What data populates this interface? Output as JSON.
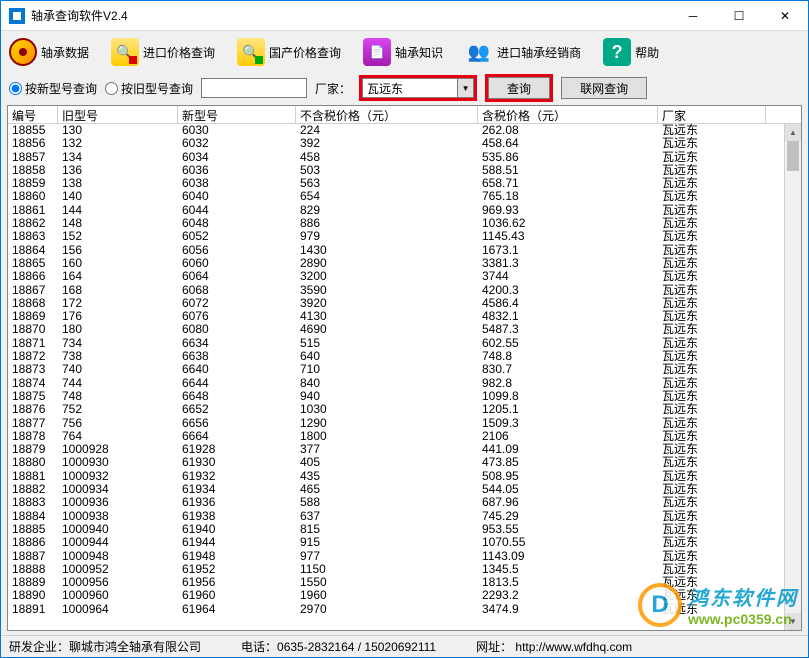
{
  "window": {
    "title": "轴承查询软件V2.4"
  },
  "toolbar": {
    "data": "轴承数据",
    "import_price": "进口价格查询",
    "domestic_price": "国产价格查询",
    "knowledge": "轴承知识",
    "dealer": "进口轴承经销商",
    "help": "帮助"
  },
  "search": {
    "by_new": "按新型号查询",
    "by_old": "按旧型号查询",
    "manufacturer_label": "厂家：",
    "manufacturer_value": "瓦远东",
    "query_btn": "查询",
    "online_btn": "联网查询"
  },
  "columns": {
    "c0": "编号",
    "c1": "旧型号",
    "c2": "新型号",
    "c3": "不含税价格（元）",
    "c4": "含税价格（元）",
    "c5": "厂家"
  },
  "rows": [
    {
      "id": "18855",
      "old": "130",
      "new": "6030",
      "pnt": "224",
      "pt": "262.08",
      "mk": "瓦远东"
    },
    {
      "id": "18856",
      "old": "132",
      "new": "6032",
      "pnt": "392",
      "pt": "458.64",
      "mk": "瓦远东"
    },
    {
      "id": "18857",
      "old": "134",
      "new": "6034",
      "pnt": "458",
      "pt": "535.86",
      "mk": "瓦远东"
    },
    {
      "id": "18858",
      "old": "136",
      "new": "6036",
      "pnt": "503",
      "pt": "588.51",
      "mk": "瓦远东"
    },
    {
      "id": "18859",
      "old": "138",
      "new": "6038",
      "pnt": "563",
      "pt": "658.71",
      "mk": "瓦远东"
    },
    {
      "id": "18860",
      "old": "140",
      "new": "6040",
      "pnt": "654",
      "pt": "765.18",
      "mk": "瓦远东"
    },
    {
      "id": "18861",
      "old": "144",
      "new": "6044",
      "pnt": "829",
      "pt": "969.93",
      "mk": "瓦远东"
    },
    {
      "id": "18862",
      "old": "148",
      "new": "6048",
      "pnt": "886",
      "pt": "1036.62",
      "mk": "瓦远东"
    },
    {
      "id": "18863",
      "old": "152",
      "new": "6052",
      "pnt": "979",
      "pt": "1145.43",
      "mk": "瓦远东"
    },
    {
      "id": "18864",
      "old": "156",
      "new": "6056",
      "pnt": "1430",
      "pt": "1673.1",
      "mk": "瓦远东"
    },
    {
      "id": "18865",
      "old": "160",
      "new": "6060",
      "pnt": "2890",
      "pt": "3381.3",
      "mk": "瓦远东"
    },
    {
      "id": "18866",
      "old": "164",
      "new": "6064",
      "pnt": "3200",
      "pt": "3744",
      "mk": "瓦远东"
    },
    {
      "id": "18867",
      "old": "168",
      "new": "6068",
      "pnt": "3590",
      "pt": "4200.3",
      "mk": "瓦远东"
    },
    {
      "id": "18868",
      "old": "172",
      "new": "6072",
      "pnt": "3920",
      "pt": "4586.4",
      "mk": "瓦远东"
    },
    {
      "id": "18869",
      "old": "176",
      "new": "6076",
      "pnt": "4130",
      "pt": "4832.1",
      "mk": "瓦远东"
    },
    {
      "id": "18870",
      "old": "180",
      "new": "6080",
      "pnt": "4690",
      "pt": "5487.3",
      "mk": "瓦远东"
    },
    {
      "id": "18871",
      "old": "734",
      "new": "6634",
      "pnt": "515",
      "pt": "602.55",
      "mk": "瓦远东"
    },
    {
      "id": "18872",
      "old": "738",
      "new": "6638",
      "pnt": "640",
      "pt": "748.8",
      "mk": "瓦远东"
    },
    {
      "id": "18873",
      "old": "740",
      "new": "6640",
      "pnt": "710",
      "pt": "830.7",
      "mk": "瓦远东"
    },
    {
      "id": "18874",
      "old": "744",
      "new": "6644",
      "pnt": "840",
      "pt": "982.8",
      "mk": "瓦远东"
    },
    {
      "id": "18875",
      "old": "748",
      "new": "6648",
      "pnt": "940",
      "pt": "1099.8",
      "mk": "瓦远东"
    },
    {
      "id": "18876",
      "old": "752",
      "new": "6652",
      "pnt": "1030",
      "pt": "1205.1",
      "mk": "瓦远东"
    },
    {
      "id": "18877",
      "old": "756",
      "new": "6656",
      "pnt": "1290",
      "pt": "1509.3",
      "mk": "瓦远东"
    },
    {
      "id": "18878",
      "old": "764",
      "new": "6664",
      "pnt": "1800",
      "pt": "2106",
      "mk": "瓦远东"
    },
    {
      "id": "18879",
      "old": "1000928",
      "new": "61928",
      "pnt": "377",
      "pt": "441.09",
      "mk": "瓦远东"
    },
    {
      "id": "18880",
      "old": "1000930",
      "new": "61930",
      "pnt": "405",
      "pt": "473.85",
      "mk": "瓦远东"
    },
    {
      "id": "18881",
      "old": "1000932",
      "new": "61932",
      "pnt": "435",
      "pt": "508.95",
      "mk": "瓦远东"
    },
    {
      "id": "18882",
      "old": "1000934",
      "new": "61934",
      "pnt": "465",
      "pt": "544.05",
      "mk": "瓦远东"
    },
    {
      "id": "18883",
      "old": "1000936",
      "new": "61936",
      "pnt": "588",
      "pt": "687.96",
      "mk": "瓦远东"
    },
    {
      "id": "18884",
      "old": "1000938",
      "new": "61938",
      "pnt": "637",
      "pt": "745.29",
      "mk": "瓦远东"
    },
    {
      "id": "18885",
      "old": "1000940",
      "new": "61940",
      "pnt": "815",
      "pt": "953.55",
      "mk": "瓦远东"
    },
    {
      "id": "18886",
      "old": "1000944",
      "new": "61944",
      "pnt": "915",
      "pt": "1070.55",
      "mk": "瓦远东"
    },
    {
      "id": "18887",
      "old": "1000948",
      "new": "61948",
      "pnt": "977",
      "pt": "1143.09",
      "mk": "瓦远东"
    },
    {
      "id": "18888",
      "old": "1000952",
      "new": "61952",
      "pnt": "1150",
      "pt": "1345.5",
      "mk": "瓦远东"
    },
    {
      "id": "18889",
      "old": "1000956",
      "new": "61956",
      "pnt": "1550",
      "pt": "1813.5",
      "mk": "瓦远东"
    },
    {
      "id": "18890",
      "old": "1000960",
      "new": "61960",
      "pnt": "1960",
      "pt": "2293.2",
      "mk": "瓦远东"
    },
    {
      "id": "18891",
      "old": "1000964",
      "new": "61964",
      "pnt": "2970",
      "pt": "3474.9",
      "mk": "瓦远东"
    }
  ],
  "status": {
    "company": "研发企业：聊城市鸿全轴承有限公司",
    "phone": "电话：0635-2832164  /  15020692111",
    "url_label": "网址：",
    "url": "http://www.wfdhq.com"
  },
  "watermark": {
    "name": "鸿东软件网",
    "url": "www.pc0359.cn"
  }
}
